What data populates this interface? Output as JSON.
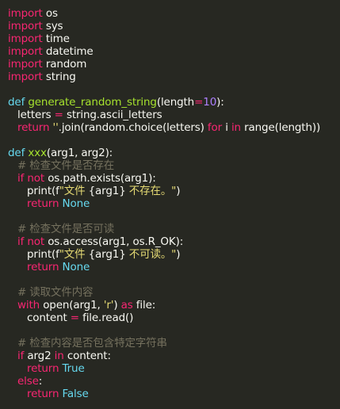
{
  "editor": {
    "lines": [
      {
        "indent": 0,
        "tokens": [
          {
            "t": "kw",
            "v": "import"
          },
          {
            "t": "txt",
            "v": " os"
          }
        ]
      },
      {
        "indent": 0,
        "tokens": [
          {
            "t": "kw",
            "v": "import"
          },
          {
            "t": "txt",
            "v": " sys"
          }
        ]
      },
      {
        "indent": 0,
        "tokens": [
          {
            "t": "kw",
            "v": "import"
          },
          {
            "t": "txt",
            "v": " time"
          }
        ]
      },
      {
        "indent": 0,
        "tokens": [
          {
            "t": "kw",
            "v": "import"
          },
          {
            "t": "txt",
            "v": " datetime"
          }
        ]
      },
      {
        "indent": 0,
        "tokens": [
          {
            "t": "kw",
            "v": "import"
          },
          {
            "t": "txt",
            "v": " random"
          }
        ]
      },
      {
        "indent": 0,
        "tokens": [
          {
            "t": "kw",
            "v": "import"
          },
          {
            "t": "txt",
            "v": " string"
          }
        ]
      },
      {
        "indent": 0,
        "tokens": []
      },
      {
        "indent": 0,
        "tokens": [
          {
            "t": "bi",
            "v": "def"
          },
          {
            "t": "txt",
            "v": " "
          },
          {
            "t": "fn",
            "v": "generate_random_string"
          },
          {
            "t": "txt",
            "v": "(length"
          },
          {
            "t": "op",
            "v": "="
          },
          {
            "t": "num",
            "v": "10"
          },
          {
            "t": "txt",
            "v": "):"
          }
        ]
      },
      {
        "indent": 1,
        "tokens": [
          {
            "t": "txt",
            "v": "letters "
          },
          {
            "t": "op",
            "v": "="
          },
          {
            "t": "txt",
            "v": " string.ascii_letters"
          }
        ]
      },
      {
        "indent": 1,
        "tokens": [
          {
            "t": "kw",
            "v": "return"
          },
          {
            "t": "txt",
            "v": " "
          },
          {
            "t": "str",
            "v": "''"
          },
          {
            "t": "txt",
            "v": ".join(random.choice(letters) "
          },
          {
            "t": "kw",
            "v": "for"
          },
          {
            "t": "txt",
            "v": " i "
          },
          {
            "t": "kw",
            "v": "in"
          },
          {
            "t": "txt",
            "v": " range(length))"
          }
        ]
      },
      {
        "indent": 0,
        "tokens": []
      },
      {
        "indent": 0,
        "tokens": [
          {
            "t": "bi",
            "v": "def"
          },
          {
            "t": "txt",
            "v": " "
          },
          {
            "t": "fn",
            "v": "xxx"
          },
          {
            "t": "txt",
            "v": "(arg1, arg2):"
          }
        ]
      },
      {
        "indent": 1,
        "tokens": [
          {
            "t": "cm",
            "v": "# 检查文件是否存在"
          }
        ]
      },
      {
        "indent": 1,
        "tokens": [
          {
            "t": "kw",
            "v": "if"
          },
          {
            "t": "txt",
            "v": " "
          },
          {
            "t": "kw",
            "v": "not"
          },
          {
            "t": "txt",
            "v": " os.path.exists(arg1):"
          }
        ]
      },
      {
        "indent": 2,
        "tokens": [
          {
            "t": "txt",
            "v": "print(f"
          },
          {
            "t": "str",
            "v": "\"文件 "
          },
          {
            "t": "txt",
            "v": "{arg1}"
          },
          {
            "t": "str",
            "v": " 不存在。\""
          },
          {
            "t": "txt",
            "v": ")"
          }
        ]
      },
      {
        "indent": 2,
        "tokens": [
          {
            "t": "kw",
            "v": "return"
          },
          {
            "t": "txt",
            "v": " "
          },
          {
            "t": "bi",
            "v": "None"
          }
        ]
      },
      {
        "indent": 0,
        "tokens": []
      },
      {
        "indent": 1,
        "tokens": [
          {
            "t": "cm",
            "v": "# 检查文件是否可读"
          }
        ]
      },
      {
        "indent": 1,
        "tokens": [
          {
            "t": "kw",
            "v": "if"
          },
          {
            "t": "txt",
            "v": " "
          },
          {
            "t": "kw",
            "v": "not"
          },
          {
            "t": "txt",
            "v": " os.access(arg1, os.R_OK):"
          }
        ]
      },
      {
        "indent": 2,
        "tokens": [
          {
            "t": "txt",
            "v": "print(f"
          },
          {
            "t": "str",
            "v": "\"文件 "
          },
          {
            "t": "txt",
            "v": "{arg1}"
          },
          {
            "t": "str",
            "v": " 不可读。\""
          },
          {
            "t": "txt",
            "v": ")"
          }
        ]
      },
      {
        "indent": 2,
        "tokens": [
          {
            "t": "kw",
            "v": "return"
          },
          {
            "t": "txt",
            "v": " "
          },
          {
            "t": "bi",
            "v": "None"
          }
        ]
      },
      {
        "indent": 0,
        "tokens": []
      },
      {
        "indent": 1,
        "tokens": [
          {
            "t": "cm",
            "v": "# 读取文件内容"
          }
        ]
      },
      {
        "indent": 1,
        "tokens": [
          {
            "t": "kw",
            "v": "with"
          },
          {
            "t": "txt",
            "v": " open(arg1, "
          },
          {
            "t": "str",
            "v": "'r'"
          },
          {
            "t": "txt",
            "v": ") "
          },
          {
            "t": "kw",
            "v": "as"
          },
          {
            "t": "txt",
            "v": " file:"
          }
        ]
      },
      {
        "indent": 2,
        "tokens": [
          {
            "t": "txt",
            "v": "content "
          },
          {
            "t": "op",
            "v": "="
          },
          {
            "t": "txt",
            "v": " file.read()"
          }
        ]
      },
      {
        "indent": 0,
        "tokens": []
      },
      {
        "indent": 1,
        "tokens": [
          {
            "t": "cm",
            "v": "# 检查内容是否包含特定字符串"
          }
        ]
      },
      {
        "indent": 1,
        "tokens": [
          {
            "t": "kw",
            "v": "if"
          },
          {
            "t": "txt",
            "v": " arg2 "
          },
          {
            "t": "kw",
            "v": "in"
          },
          {
            "t": "txt",
            "v": " content:"
          }
        ]
      },
      {
        "indent": 2,
        "tokens": [
          {
            "t": "kw",
            "v": "return"
          },
          {
            "t": "txt",
            "v": " "
          },
          {
            "t": "bi",
            "v": "True"
          }
        ]
      },
      {
        "indent": 1,
        "tokens": [
          {
            "t": "kw",
            "v": "else"
          },
          {
            "t": "txt",
            "v": ":"
          }
        ]
      },
      {
        "indent": 2,
        "tokens": [
          {
            "t": "kw",
            "v": "return"
          },
          {
            "t": "txt",
            "v": " "
          },
          {
            "t": "bi",
            "v": "False"
          }
        ]
      }
    ]
  },
  "theme": {
    "background": "#272822",
    "text": "#f8f8f2",
    "keyword": "#f92672",
    "function": "#a6e22e",
    "number": "#ae81ff",
    "string": "#e6db74",
    "builtin": "#66d9ef",
    "comment": "#75715e"
  }
}
